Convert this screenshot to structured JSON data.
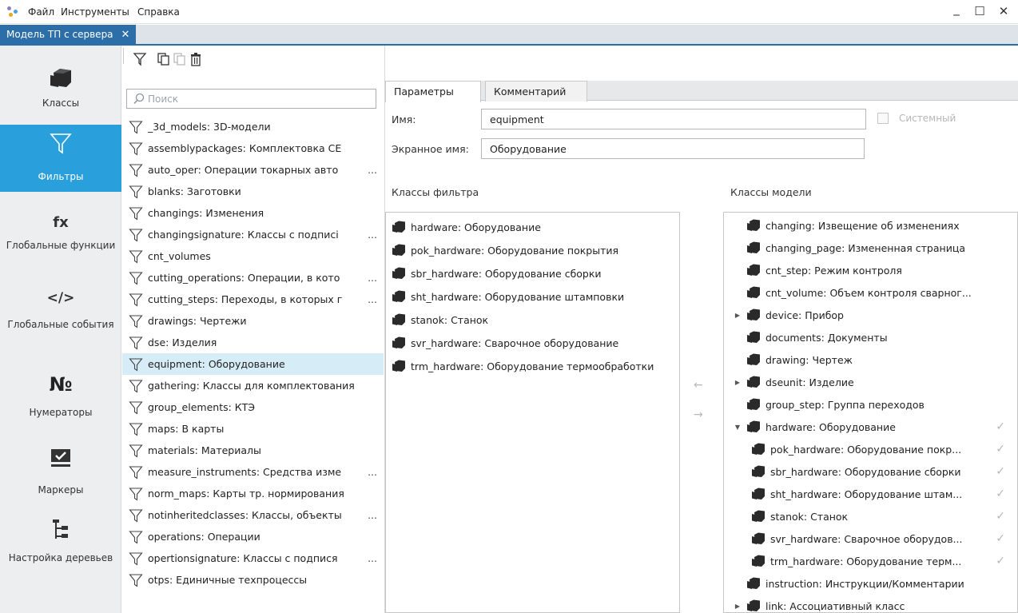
{
  "menubar": {
    "items": [
      "Файл",
      "Инструменты",
      "Справка"
    ],
    "minimize": "_",
    "maximize": "☐",
    "close": "✕"
  },
  "doc_tab": {
    "label": "Модель ТП с сервера",
    "close": "✕"
  },
  "nav": [
    {
      "id": "classes",
      "label": "Классы",
      "icon": "class-block-icon",
      "active": false
    },
    {
      "id": "filters",
      "label": "Фильтры",
      "icon": "filter-icon",
      "active": true
    },
    {
      "id": "globalfuncs",
      "label": "Глобальные функции",
      "icon": "fx-icon",
      "icon_text": "fx",
      "active": false
    },
    {
      "id": "globalevents",
      "label": "Глобальные события",
      "icon": "code-tag-icon",
      "icon_text": "</>",
      "active": false
    },
    {
      "id": "numerators",
      "label": "Нумераторы",
      "icon": "numero-icon",
      "icon_text": "№",
      "active": false
    },
    {
      "id": "markers",
      "label": "Маркеры",
      "icon": "marker-check-icon",
      "active": false
    },
    {
      "id": "trees",
      "label": "Настройка деревьев",
      "icon": "tree-settings-icon",
      "active": false
    }
  ],
  "search": {
    "placeholder": "Поиск"
  },
  "filters": [
    {
      "text": "_3d_models: 3D-модели"
    },
    {
      "text": "assemblypackages: Комплектовка СЕ"
    },
    {
      "text": "auto_oper: Операции токарных авто",
      "ellipsis": true
    },
    {
      "text": "blanks: Заготовки"
    },
    {
      "text": "changings: Изменения"
    },
    {
      "text": "changingsignature: Классы с подписі",
      "ellipsis": true
    },
    {
      "text": "cnt_volumes"
    },
    {
      "text": "cutting_operations: Операции, в кото",
      "ellipsis": true
    },
    {
      "text": "cutting_steps: Переходы, в которых г",
      "ellipsis": true
    },
    {
      "text": "drawings: Чертежи"
    },
    {
      "text": "dse: Изделия"
    },
    {
      "text": "equipment: Оборудование",
      "selected": true
    },
    {
      "text": "gathering: Классы для комплектования"
    },
    {
      "text": "group_elements: КТЭ"
    },
    {
      "text": "maps: В карты"
    },
    {
      "text": "materials: Материалы"
    },
    {
      "text": "measure_instruments: Средства изме",
      "ellipsis": true
    },
    {
      "text": "norm_maps: Карты тр. нормирования"
    },
    {
      "text": "notinheritedclasses: Классы, объекты",
      "ellipsis": true
    },
    {
      "text": "operations: Операции"
    },
    {
      "text": "opertionsignature: Классы с подпися",
      "ellipsis": true
    },
    {
      "text": "otps: Единичные техпроцессы"
    }
  ],
  "tabs": {
    "params": "Параметры",
    "comment": "Комментарий"
  },
  "params": {
    "name_label": "Имя:",
    "name_value": "equipment",
    "screen_label": "Экранное имя:",
    "screen_value": "Оборудование",
    "system_label": "Системный"
  },
  "filter_classes": {
    "title": "Классы фильтра",
    "items": [
      "hardware: Оборудование",
      "pok_hardware: Оборудование покрытия",
      "sbr_hardware: Оборудование сборки",
      "sht_hardware: Оборудование штамповки",
      "stanok: Станок",
      "svr_hardware: Сварочное оборудование",
      "trm_hardware: Оборудование термообработки"
    ]
  },
  "model_classes": {
    "title": "Классы модели",
    "items": [
      {
        "text": "changing: Извещение об изменениях",
        "level": 0
      },
      {
        "text": "changing_page: Измененная страница",
        "level": 0
      },
      {
        "text": "cnt_step: Режим контроля",
        "level": 0
      },
      {
        "text": "cnt_volume: Объем контроля сварног...",
        "level": 0
      },
      {
        "text": "device: Прибор",
        "level": 0,
        "expander": "▶"
      },
      {
        "text": "documents: Документы",
        "level": 0
      },
      {
        "text": "drawing: Чертеж",
        "level": 0
      },
      {
        "text": "dseunit: Изделие",
        "level": 0,
        "expander": "▶"
      },
      {
        "text": "group_step: Группа переходов",
        "level": 0
      },
      {
        "text": "hardware: Оборудование",
        "level": 0,
        "expander": "▼",
        "check": true
      },
      {
        "text": "pok_hardware: Оборудование покр...",
        "level": 1,
        "check": true
      },
      {
        "text": "sbr_hardware: Оборудование сборки",
        "level": 1,
        "check": true
      },
      {
        "text": "sht_hardware: Оборудование штам...",
        "level": 1,
        "check": true
      },
      {
        "text": "stanok: Станок",
        "level": 1,
        "check": true
      },
      {
        "text": "svr_hardware: Сварочное оборудов...",
        "level": 1,
        "check": true
      },
      {
        "text": "trm_hardware: Оборудование терм...",
        "level": 1,
        "check": true
      },
      {
        "text": "instruction: Инструкции/Комментарии",
        "level": 0
      },
      {
        "text": "link: Ассоциативный класс",
        "level": 0,
        "expander": "▶"
      }
    ]
  },
  "move": {
    "left": "←",
    "right": "→"
  }
}
